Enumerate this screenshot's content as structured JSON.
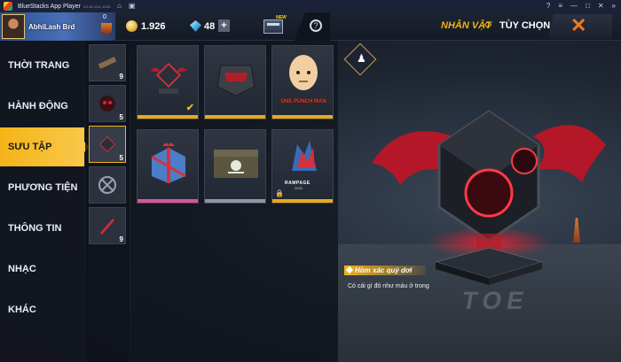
{
  "emulator": {
    "title": "BlueStacks App Player",
    "subtitle": "4.2.61.1111 1004",
    "window_buttons": [
      "?",
      "≡",
      "—",
      "□",
      "✕",
      "»"
    ]
  },
  "topbar": {
    "player_name": "AbhiLash Brd",
    "level": "0",
    "gold": "1.926",
    "diamonds": "48",
    "plus": "+",
    "new_tag": "NEW",
    "nav_character": "NHÂN VẬT",
    "nav_options": "TÙY CHỌN",
    "close": "✕"
  },
  "sidebar": {
    "items": [
      {
        "label": "THỜI TRANG"
      },
      {
        "label": "HÀNH ĐỘNG"
      },
      {
        "label": "SƯU TẬP"
      },
      {
        "label": "PHƯƠNG TIỆN"
      },
      {
        "label": "THÔNG TIN"
      },
      {
        "label": "NHẠC"
      },
      {
        "label": "KHÁC"
      }
    ],
    "active_index": 2
  },
  "subcategories": [
    {
      "count": "9"
    },
    {
      "count": "5"
    },
    {
      "count": "5"
    },
    {
      "count": ""
    },
    {
      "count": "9"
    }
  ],
  "grid": {
    "items": [
      {
        "name": "Hòm xác quỷ dơi",
        "rarity": "gold",
        "equipped": true
      },
      {
        "name": "Hòm mặt nạ đỏ",
        "rarity": "gold",
        "equipped": false
      },
      {
        "name": "One Punch Man",
        "rarity": "gold",
        "equipped": false,
        "label": "ONE PUNCH MAN"
      },
      {
        "name": "Hộp quà",
        "rarity": "pink",
        "equipped": false
      },
      {
        "name": "Hòm hải tặc",
        "rarity": "grey",
        "equipped": false
      },
      {
        "name": "Rampage",
        "rarity": "gold",
        "equipped": false,
        "locked": true,
        "label": "RAMPAGE",
        "year": "2020"
      }
    ]
  },
  "showcase": {
    "item_title": "Hòm xác quỷ dơi",
    "item_desc": "Có cái gì đỏ như máu ở trong",
    "road_text": "TOE"
  },
  "colors": {
    "accent": "#f5b418",
    "close": "#f07a1e",
    "rarity_gold": "#e8a91a",
    "rarity_pink": "#d8569a"
  }
}
